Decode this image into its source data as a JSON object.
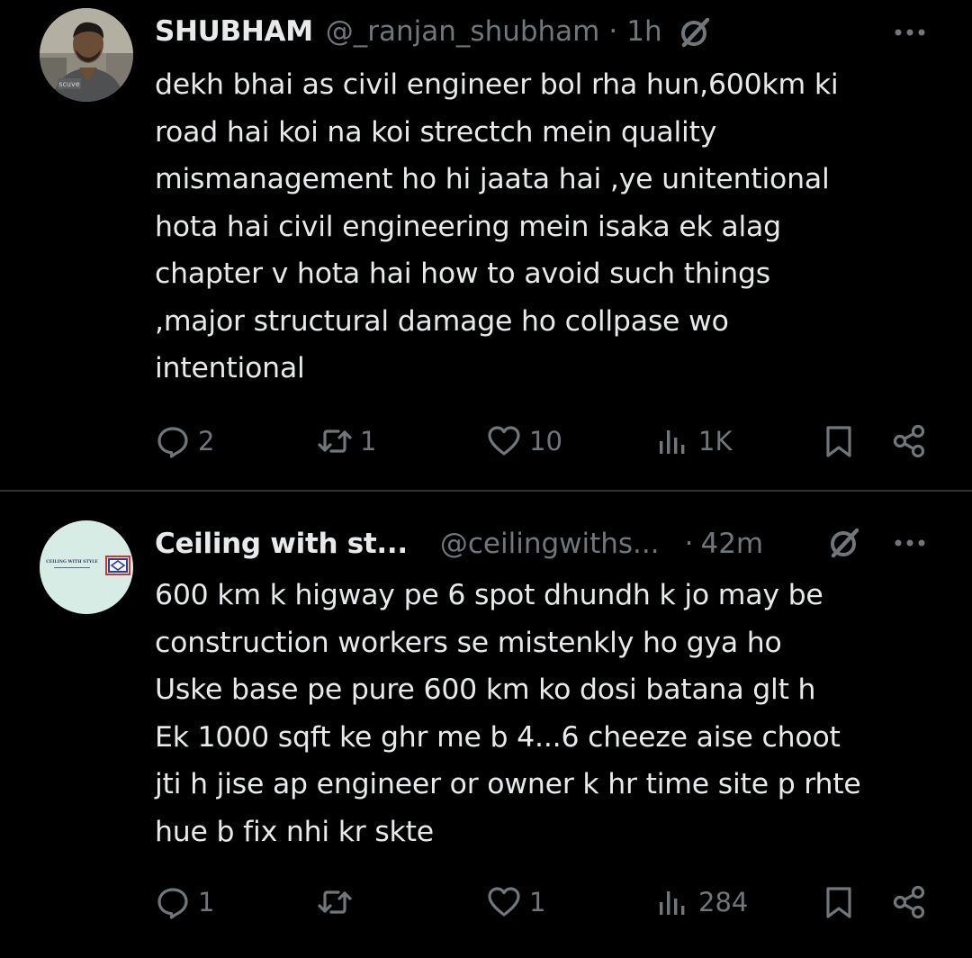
{
  "tweets": [
    {
      "display_name": "SHUBHAM",
      "handle": "@_ranjan_shubham",
      "separator": "·",
      "time": "1h",
      "avatar_badge_text": "scuve",
      "text": "dekh bhai as  civil engineer bol rha hun,600km ki\nroad hai koi na koi strectch mein quality\nmismanagement ho hi jaata hai ,ye unitentional\nhota hai civil engineering mein isaka ek alag\nchapter v hota hai how to avoid such things\n,major structural damage ho collpase wo\nintentional",
      "actions": {
        "replies": "2",
        "reposts": "1",
        "likes": "10",
        "views": "1K"
      }
    },
    {
      "display_name": "Ceiling with st...",
      "handle": "@ceilingwiths...",
      "separator": "·",
      "time": "42m",
      "avatar_logo_text": "CEILING WITH STYLE",
      "text": "600 km k higway pe 6 spot dhundh k jo may be\nconstruction workers se mistenkly ho gya ho\nUske base pe pure 600 km ko dosi batana glt h\nEk 1000 sqft ke ghr me b 4...6 cheeze aise choot\njti h jise ap engineer or owner k hr time site p rhte\nhue b fix nhi kr skte",
      "actions": {
        "replies": "1",
        "reposts": "",
        "likes": "1",
        "views": "284"
      }
    }
  ],
  "icons": {
    "reply": "reply-icon",
    "repost": "repost-icon",
    "like": "heart-icon",
    "views": "views-icon",
    "bookmark": "bookmark-icon",
    "share": "share-icon",
    "grok": "grok-icon",
    "more": "more-icon"
  },
  "colors": {
    "background": "#000000",
    "text": "#e7e9ea",
    "secondary": "#71767b",
    "divider": "#2f3336",
    "avatar2_bg": "#d8ece6"
  }
}
